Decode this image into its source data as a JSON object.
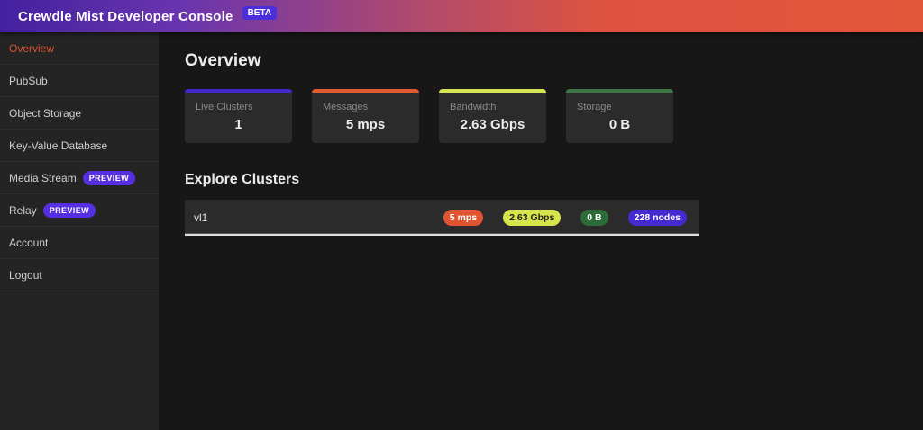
{
  "header": {
    "title": "Crewdle Mist Developer Console",
    "beta_badge": "BETA"
  },
  "sidebar": {
    "items": [
      {
        "label": "Overview",
        "active": true
      },
      {
        "label": "PubSub"
      },
      {
        "label": "Object Storage"
      },
      {
        "label": "Key-Value Database"
      },
      {
        "label": "Media Stream",
        "badge": "PREVIEW"
      },
      {
        "label": "Relay",
        "badge": "PREVIEW"
      },
      {
        "label": "Account"
      },
      {
        "label": "Logout"
      }
    ]
  },
  "main": {
    "title": "Overview",
    "stats": [
      {
        "label": "Live Clusters",
        "value": "1",
        "accent": "#4229cc"
      },
      {
        "label": "Messages",
        "value": "5 mps",
        "accent": "#e05a32"
      },
      {
        "label": "Bandwidth",
        "value": "2.63 Gbps",
        "accent": "#d4e455"
      },
      {
        "label": "Storage",
        "value": "0 B",
        "accent": "#3e7747"
      }
    ],
    "clusters": {
      "title": "Explore Clusters",
      "rows": [
        {
          "name": "vl1",
          "badges": [
            {
              "text": "5 mps",
              "bg": "#e05432",
              "fg": "#ffffff"
            },
            {
              "text": "2.63 Gbps",
              "bg": "#d6e54c",
              "fg": "#1c1c1c"
            },
            {
              "text": "0 B",
              "bg": "#2d6b39",
              "fg": "#ffffff"
            },
            {
              "text": "228 nodes",
              "bg": "#4629cf",
              "fg": "#ffffff"
            }
          ]
        }
      ]
    }
  },
  "colors": {
    "header_gradient_start": "#43219f",
    "header_gradient_end": "#e2563a",
    "beta_badge_bg": "#4a2ddb",
    "preview_badge_bg": "#5630e0",
    "active_nav": "#d9532f",
    "sidebar_bg": "#242424",
    "main_bg": "#171717",
    "card_bg": "#2b2b2b"
  }
}
